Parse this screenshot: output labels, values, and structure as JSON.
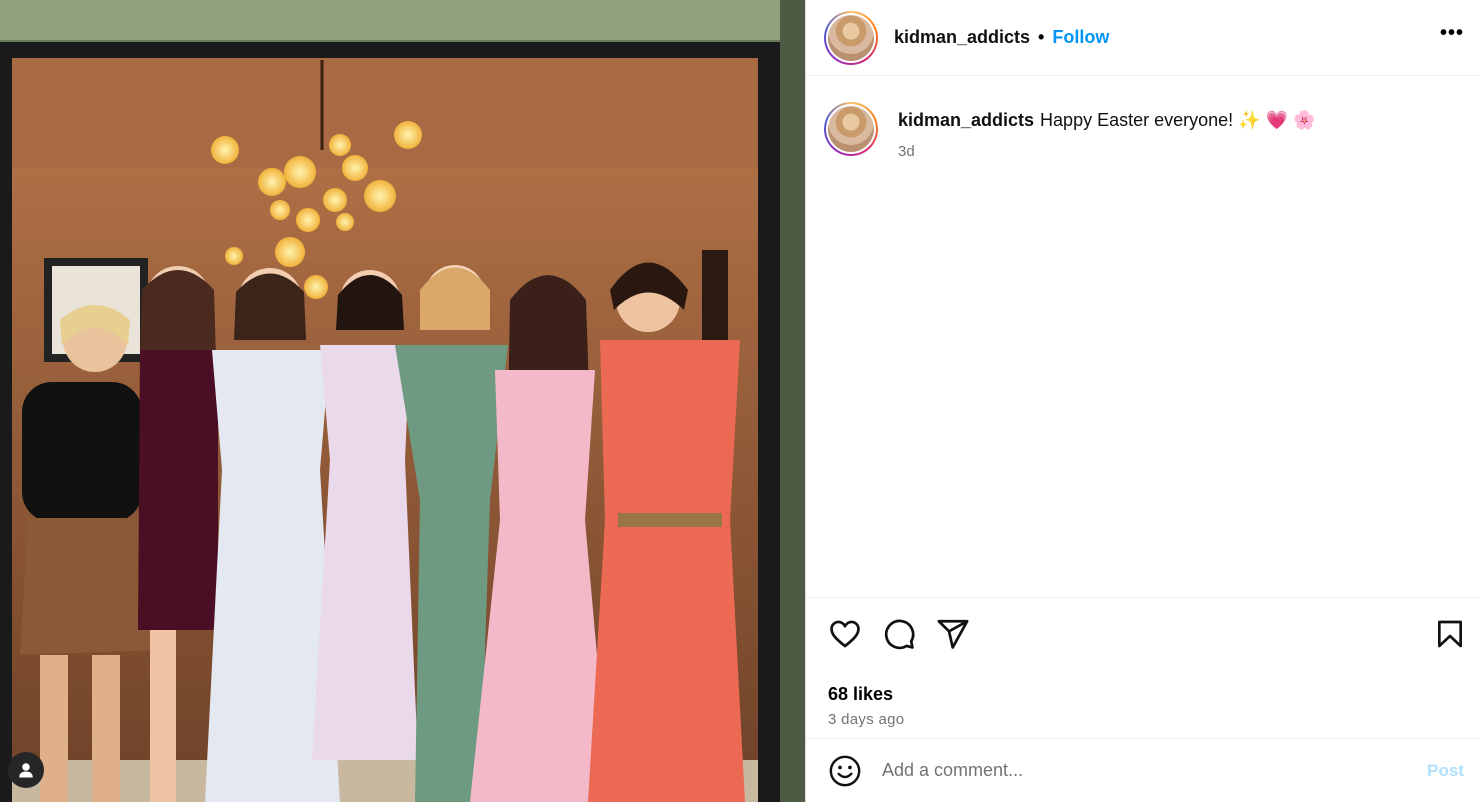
{
  "post": {
    "image_alt": "Seven women in dresses standing together under a chandelier",
    "tag_icon": "user-tag-icon"
  },
  "header": {
    "username": "kidman_addicts",
    "separator": "•",
    "follow_label": "Follow",
    "more_label": "•••"
  },
  "caption": {
    "username": "kidman_addicts",
    "text": "Happy Easter everyone! ✨ 💗 🌸",
    "time": "3d"
  },
  "actions": {
    "icons": [
      "heart-icon",
      "comment-icon",
      "share-icon",
      "bookmark-icon"
    ],
    "likes": "68 likes",
    "posted_ago": "3 days ago"
  },
  "comment": {
    "placeholder": "Add a comment...",
    "post_label": "Post"
  },
  "colors": {
    "accent": "#0095f6",
    "post_disabled": "#b2dffc",
    "secondary_text": "#737373"
  }
}
